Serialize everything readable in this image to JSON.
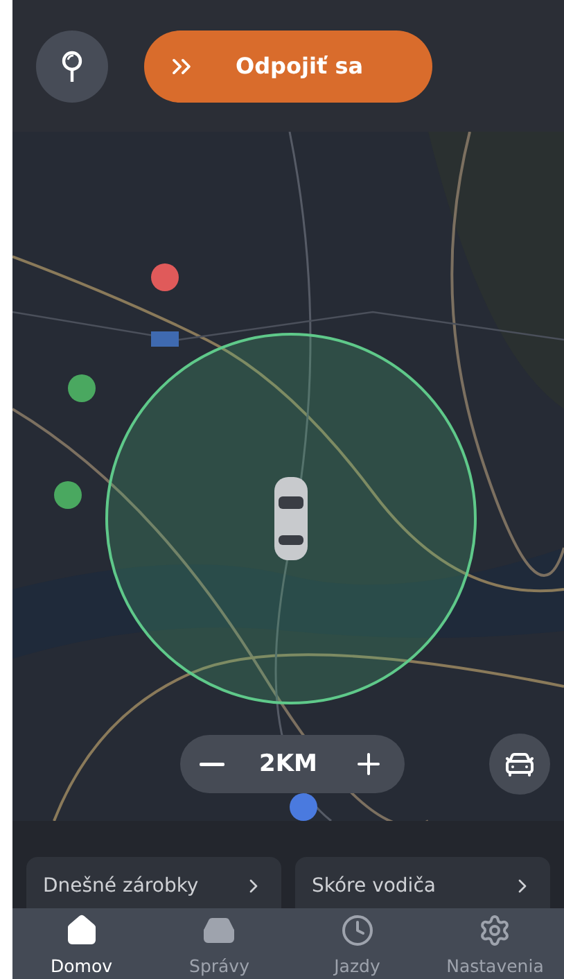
{
  "top_bar": {
    "action_button": {
      "label": "Odpojiť sa"
    }
  },
  "map": {
    "zoom_control": {
      "value": "2KM"
    }
  },
  "cards": [
    {
      "label": "Dnešné zárobky"
    },
    {
      "label": "Skóre vodiča"
    }
  ],
  "tabs": [
    {
      "label": "Domov",
      "kind": "home",
      "selected": true
    },
    {
      "label": "Správy",
      "kind": "inbox",
      "selected": false
    },
    {
      "label": "Jazdy",
      "kind": "clock",
      "selected": false
    },
    {
      "label": "Nastavenia",
      "kind": "gear",
      "selected": false
    }
  ]
}
